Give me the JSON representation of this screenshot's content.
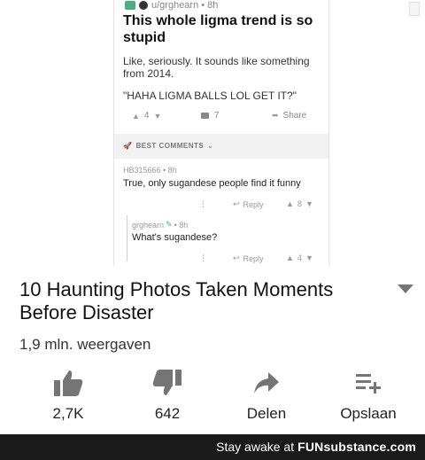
{
  "post": {
    "meta_text": "u/grghearn • 8h",
    "title": "This whole ligma trend is so stupid",
    "body": "Like, seriously. It sounds like something from 2014.",
    "quote": "\"HAHA LIGMA BALLS LOL GET IT?\"",
    "votes": "4",
    "comments": "7",
    "share_label": "Share"
  },
  "best_comments_label": "BEST COMMENTS",
  "comment1": {
    "author_meta": "HB315666 • 8h",
    "text": "True, only sugandese people find it funny",
    "reply_label": "Reply",
    "votes": "8"
  },
  "comment2": {
    "author_name": "grghearn",
    "author_time": "• 8h",
    "text": "What's sugandese?",
    "reply_label": "Reply",
    "votes": "4"
  },
  "video": {
    "title": "10 Haunting Photos Taken Moments Before Disaster",
    "views": "1,9 mln. weergaven"
  },
  "actions": {
    "like_count": "2,7K",
    "dislike_count": "642",
    "share_label": "Delen",
    "save_label": "Opslaan"
  },
  "footer": {
    "prefix": "Stay awake at",
    "brand_fun": "FUN",
    "brand_rest": "substance.com"
  },
  "colors": {
    "footer_bg": "#1a1a1a",
    "icon_gray": "#757575",
    "subreddit_green": "#4cae7a"
  }
}
